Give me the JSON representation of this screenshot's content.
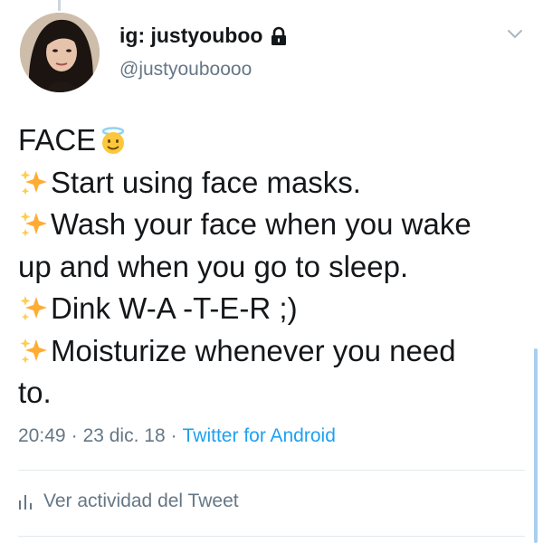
{
  "author": {
    "display_name": "ig: justyouboo",
    "handle": "@justyouboooo",
    "protected": true
  },
  "tweet": {
    "title": "FACE",
    "lines": [
      "Start using face masks.",
      "Wash your face when you wake",
      "up and when you go to sleep.",
      "Dink W-A -T-E-R ;)",
      "Moisturize whenever you need",
      "to."
    ]
  },
  "meta": {
    "time": "20:49",
    "separator": "·",
    "date": "23 dic. 18",
    "source": "Twitter for Android"
  },
  "activity": {
    "label": "Ver actividad del Tweet"
  },
  "icons": {
    "lock": "lock-icon",
    "chevron": "chevron-down-icon",
    "sparkles": "sparkles-icon",
    "angel": "smiling-face-with-halo-icon",
    "stats": "bar-chart-icon"
  },
  "colors": {
    "text": "#14171a",
    "secondary": "#657786",
    "link": "#1da1f2",
    "divider": "#e1e8ed"
  }
}
